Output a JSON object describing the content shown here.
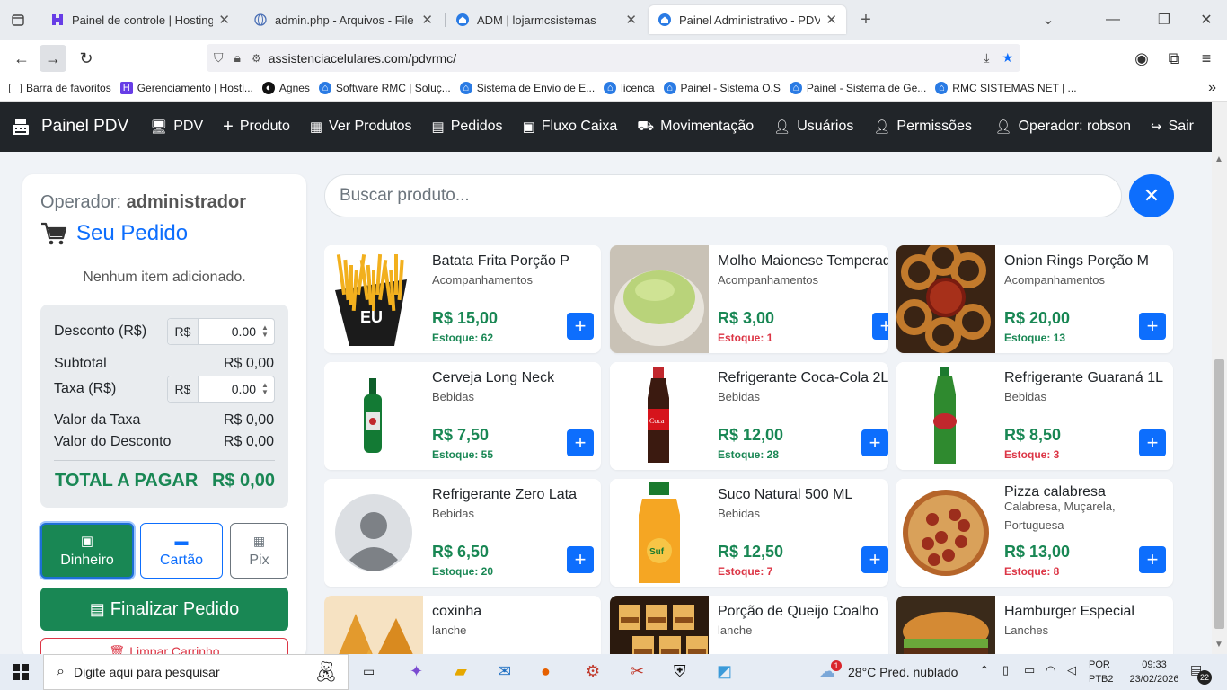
{
  "browser": {
    "tabs": [
      {
        "title": "Painel de controle | Hostinger",
        "icon": "hostinger-icon"
      },
      {
        "title": "admin.php - Arquivos - File Browser",
        "icon": "globe-icon"
      },
      {
        "title": "ADM | lojarmcsistemas",
        "icon": "home-icon"
      },
      {
        "title": "Painel Administrativo - PDV",
        "icon": "home-icon"
      }
    ],
    "url": "assistenciacelulares.com/pdvrmc/",
    "bookmarks": [
      "Barra de favoritos",
      "Gerenciamento | Hosti...",
      "Agnes",
      "Software RMC | Soluç...",
      "Sistema de Envio de E...",
      "licenca",
      "Painel - Sistema O.S",
      "Painel - Sistema de Ge...",
      "RMC SISTEMAS NET | ..."
    ]
  },
  "appnav": {
    "brand": "Painel PDV",
    "items": [
      "PDV",
      "Produto",
      "Ver Produtos",
      "Pedidos",
      "Fluxo Caixa",
      "Movimentação",
      "Usuários",
      "Permissões"
    ],
    "operator": "Operador: robson",
    "logout": "Sair"
  },
  "order": {
    "operator_label": "Operador:",
    "operator_name": "administrador",
    "title": "Seu Pedido",
    "empty": "Nenhum item adicionado.",
    "discount_label": "Desconto (R$)",
    "currency_prefix": "R$",
    "discount_value": "0.00",
    "subtotal_label": "Subtotal",
    "subtotal_value": "R$ 0,00",
    "tax_label": "Taxa (R$)",
    "tax_value": "0.00",
    "tax_amount_label": "Valor da Taxa",
    "tax_amount_value": "R$ 0,00",
    "discount_amount_label": "Valor do Desconto",
    "discount_amount_value": "R$ 0,00",
    "total_label": "TOTAL A PAGAR",
    "total_value": "R$ 0,00",
    "payment_methods": [
      "Dinheiro",
      "Cartão",
      "Pix"
    ],
    "finalize": "Finalizar Pedido",
    "clear": "Limpar Carrinho"
  },
  "search": {
    "placeholder": "Buscar produto..."
  },
  "products": [
    {
      "name": "Batata Frita Porção P",
      "category": "Acompanhamentos",
      "price": "R$ 15,00",
      "stock": "Estoque: 62",
      "low": false
    },
    {
      "name": "Molho Maionese Temperada",
      "category": "Acompanhamentos",
      "price": "R$ 3,00",
      "stock": "Estoque: 1",
      "low": true
    },
    {
      "name": "Onion Rings Porção M",
      "category": "Acompanhamentos",
      "price": "R$ 20,00",
      "stock": "Estoque: 13",
      "low": false
    },
    {
      "name": "Cerveja Long Neck",
      "category": "Bebidas",
      "price": "R$ 7,50",
      "stock": "Estoque: 55",
      "low": false
    },
    {
      "name": "Refrigerante Coca-Cola 2L",
      "category": "Bebidas",
      "price": "R$ 12,00",
      "stock": "Estoque: 28",
      "low": false
    },
    {
      "name": "Refrigerante Guaraná 1L",
      "category": "Bebidas",
      "price": "R$ 8,50",
      "stock": "Estoque: 3",
      "low": true
    },
    {
      "name": "Refrigerante Zero Lata",
      "category": "Bebidas",
      "price": "R$ 6,50",
      "stock": "Estoque: 20",
      "low": false
    },
    {
      "name": "Suco Natural 500 ML",
      "category": "Bebidas",
      "price": "R$ 12,50",
      "stock": "Estoque: 7",
      "low": true
    },
    {
      "name": "Pizza calabresa",
      "category": "Calabresa, Muçarela, Portuguesa",
      "price": "R$ 13,00",
      "stock": "Estoque: 8",
      "low": true
    },
    {
      "name": "coxinha",
      "category": "lanche",
      "price": "",
      "stock": "",
      "low": false
    },
    {
      "name": "Porção de Queijo Coalho",
      "category": "lanche",
      "price": "",
      "stock": "",
      "low": false
    },
    {
      "name": "Hamburger Especial",
      "category": "Lanches",
      "price": "",
      "stock": "",
      "low": false
    }
  ],
  "taskbar": {
    "search_placeholder": "Digite aqui para pesquisar",
    "weather": "28°C  Pred. nublado",
    "lang1": "POR",
    "lang2": "PTB2",
    "time": "09:33",
    "date": "23/02/2026",
    "notifications": "22",
    "weather_badge": "1"
  },
  "colors": {
    "primary": "#0d6efd",
    "success": "#198754",
    "danger": "#dc3545",
    "nav": "#212529"
  }
}
